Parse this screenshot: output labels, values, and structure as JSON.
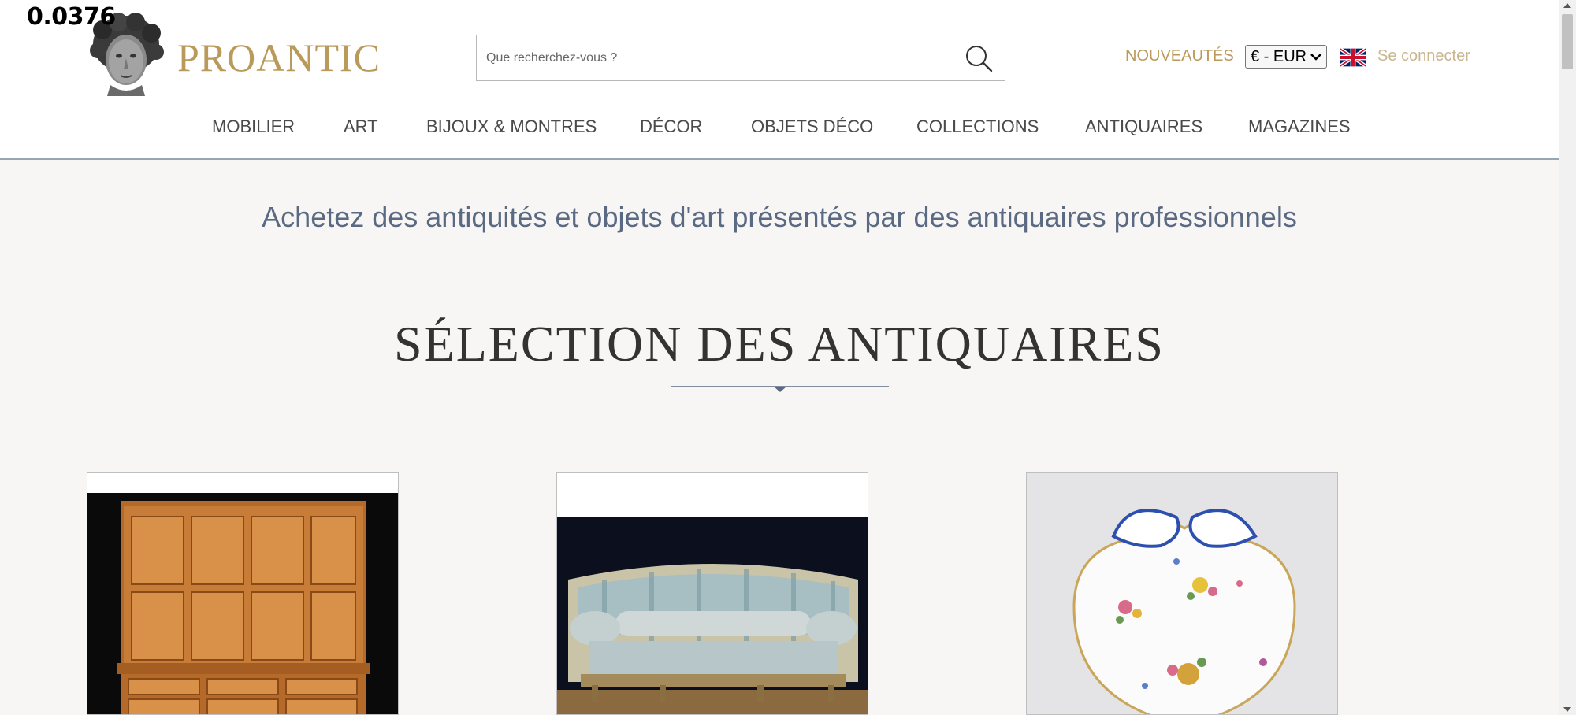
{
  "overlay": {
    "value": "0.0376"
  },
  "header": {
    "brand": "PROANTIC",
    "search_placeholder": "Que recherchez-vous ?",
    "nouveautes": "NOUVEAUTÉS",
    "currency": "€ - EUR",
    "login": "Se connecter",
    "brand_color": "#b99a5a"
  },
  "nav": {
    "items": [
      {
        "label": "MOBILIER"
      },
      {
        "label": "ART"
      },
      {
        "label": "BIJOUX & MONTRES"
      },
      {
        "label": "DÉCOR"
      },
      {
        "label": "OBJETS DÉCO"
      },
      {
        "label": "COLLECTIONS"
      },
      {
        "label": "ANTIQUAIRES"
      },
      {
        "label": "MAGAZINES"
      }
    ]
  },
  "main": {
    "tagline": "Achetez des antiquités et objets d'art présentés par des antiquaires professionnels",
    "section_title": "SÉLECTION DES ANTIQUAIRES"
  },
  "cards": [
    {
      "name": "pine-cabinet"
    },
    {
      "name": "sofa"
    },
    {
      "name": "porcelain-dish"
    }
  ]
}
